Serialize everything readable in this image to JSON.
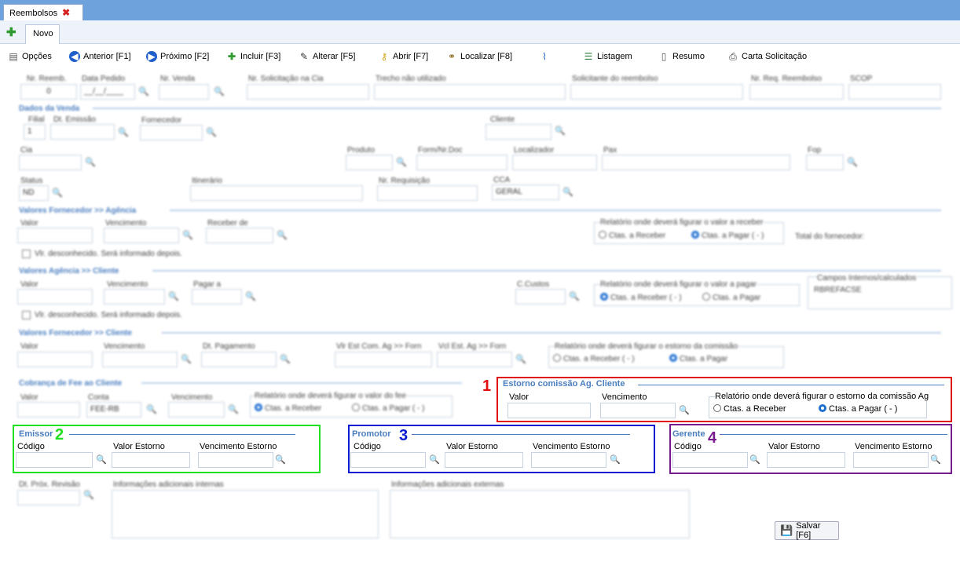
{
  "window": {
    "tab_label": "Reembolsos",
    "subtab_label": "Novo"
  },
  "toolbar": {
    "opcoes": "Opções",
    "anterior": "Anterior [F1]",
    "proximo": "Próximo [F2]",
    "incluir": "Incluir [F3]",
    "alterar": "Alterar [F5]",
    "abrir": "Abrir [F7]",
    "localizar": "Localizar [F8]",
    "listagem": "Listagem",
    "resumo": "Resumo",
    "carta": "Carta Solicitação"
  },
  "header_fields": {
    "nr_reemb": "Nr. Reemb.",
    "nr_reemb_value": "0",
    "data_pedido": "Data Pedido",
    "data_pedido_value": "__/__/____",
    "nr_venda": "Nr. Venda",
    "nr_solicitacao": "Nr. Solicitação na Cia",
    "trecho": "Trecho não utilizado",
    "solicitante": "Solicitante do reembolso",
    "nr_req": "Nr. Req. Reembolso",
    "scop": "SCOP"
  },
  "dados_venda": {
    "title": "Dados da Venda",
    "filial": "Filial",
    "filial_value": "1",
    "dt_emissao": "Dt. Emissão",
    "fornecedor": "Fornecedor",
    "cliente": "Cliente",
    "cia": "Cia",
    "produto": "Produto",
    "form_nr_doc": "Form/Nr.Doc",
    "localizador": "Localizador",
    "pax": "Pax",
    "fop": "Fop",
    "status": "Status",
    "status_value": "ND",
    "itinerario": "Itinerário",
    "nr_requisicao": "Nr. Requisição",
    "cca": "CCA",
    "cca_value": "GERAL"
  },
  "forn_agencia": {
    "title": "Valores Fornecedor >> Agência",
    "valor": "Valor",
    "vencimento": "Vencimento",
    "receber_de": "Receber de",
    "relatorio": "Relatório onde deverá figurar o valor a receber",
    "opt1": "Ctas. a Receber",
    "opt2": "Ctas. a Pagar ( - )",
    "total": "Total do fornecedor:",
    "check": "Vlr. desconhecido. Será informado depois."
  },
  "agencia_cliente": {
    "title": "Valores Agência >> Cliente",
    "valor": "Valor",
    "vencimento": "Vencimento",
    "pagar_a": "Pagar a",
    "c_custos": "C.Custos",
    "relatorio": "Relatório onde deverá figurar o valor a pagar",
    "opt1": "Ctas. a Receber ( - )",
    "opt2": "Ctas. a Pagar",
    "campos": "Campos Internos/calculados",
    "campos_value": "RBREFACSE",
    "check": "Vlr. desconhecido. Será informado depois."
  },
  "forn_cliente": {
    "title": "Valores Fornecedor >> Cliente",
    "valor": "Valor",
    "vencimento": "Vencimento",
    "dt_pagamento": "Dt. Pagamento",
    "vlr_est": "Vlr Est Com. Ag >> Forn",
    "vcl_est": "Vcl Est. Ag >> Forn",
    "relatorio": "Relatório onde deverá figurar o estorno da comissão",
    "opt1": "Ctas. a Receber ( - )",
    "opt2": "Ctas. a Pagar"
  },
  "cobranca_fee": {
    "title": "Cobrança de Fee ao Cliente",
    "valor": "Valor",
    "conta": "Conta",
    "conta_value": "FEE-RB",
    "vencimento": "Vencimento",
    "relatorio": "Relatório onde deverá figurar o valor do fee",
    "opt1": "Ctas. a Receber",
    "opt2": "Ctas. a Pagar ( - )"
  },
  "estorno": {
    "number": "1",
    "title": "Estorno comissão Ag. Cliente",
    "valor": "Valor",
    "vencimento": "Vencimento",
    "relatorio": "Relatório onde deverá figurar o estorno da comissão Ag",
    "opt1": "Ctas. a Receber",
    "opt2": "Ctas. a Pagar ( - )"
  },
  "emissor": {
    "number": "2",
    "title": "Emissor",
    "codigo": "Código",
    "valor": "Valor Estorno",
    "vencimento": "Vencimento Estorno"
  },
  "promotor": {
    "number": "3",
    "title": "Promotor",
    "codigo": "Código",
    "valor": "Valor Estorno",
    "vencimento": "Vencimento Estorno"
  },
  "gerente": {
    "number": "4",
    "title": "Gerente",
    "codigo": "Código",
    "valor": "Valor Estorno",
    "vencimento": "Vencimento Estorno"
  },
  "footer": {
    "dt_prox": "Dt. Próx. Revisão",
    "info_internas": "Informações adicionais internas",
    "info_externas": "Informações adicionais externas",
    "salvar": "Salvar [F6]"
  },
  "colors": {
    "box1": "#e01010",
    "box2": "#1fe01f",
    "box3": "#0a1ad0",
    "box4": "#7a1a8f",
    "accent": "#4a7ec0"
  }
}
